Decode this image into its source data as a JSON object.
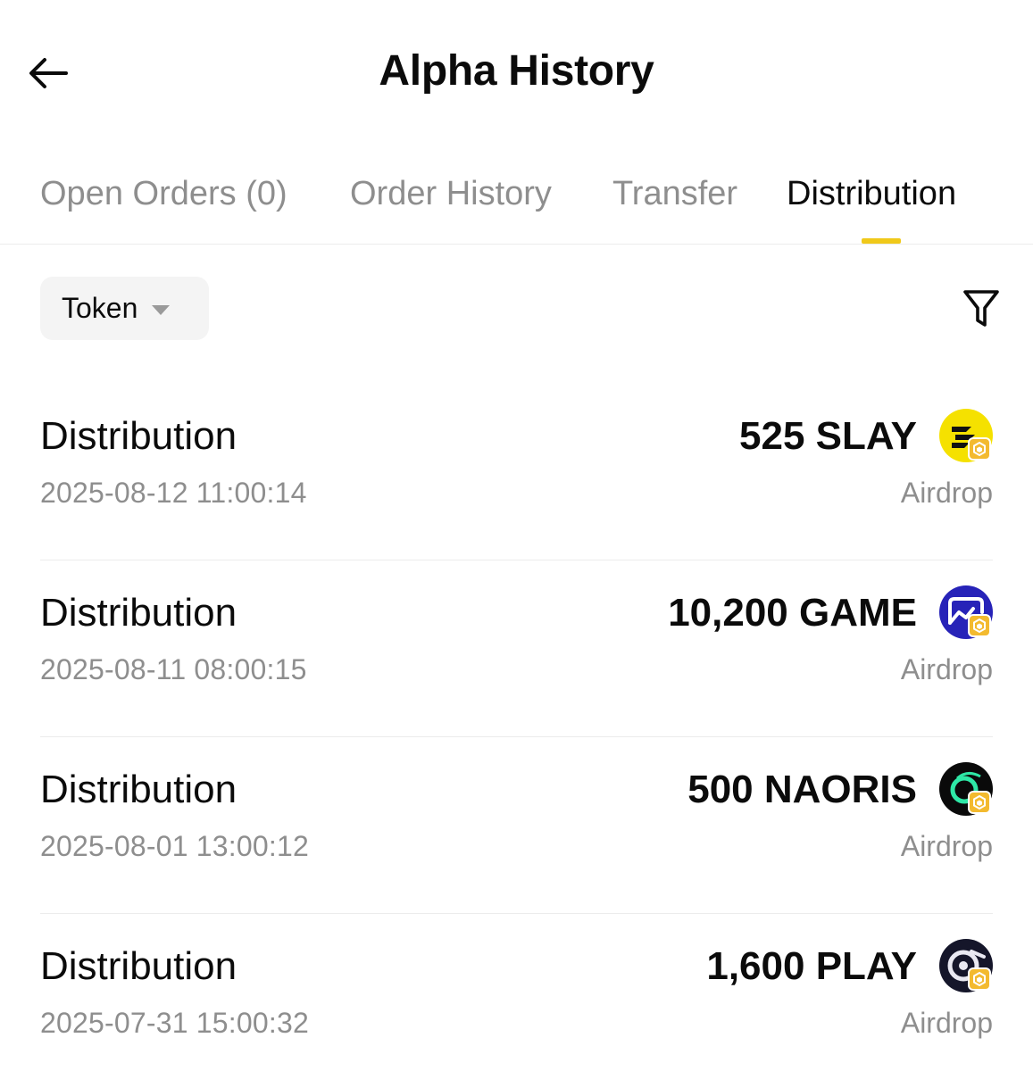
{
  "header": {
    "title": "Alpha History"
  },
  "tabs": [
    {
      "label": "Open Orders (0)",
      "active": false
    },
    {
      "label": "Order History",
      "active": false
    },
    {
      "label": "Transfer",
      "active": false
    },
    {
      "label": "Distribution",
      "active": true
    }
  ],
  "filter": {
    "token_label": "Token"
  },
  "colors": {
    "accent": "#f0c91a",
    "muted_text": "#8e8e8e",
    "divider": "#ececec"
  },
  "rows": [
    {
      "type": "Distribution",
      "date": "2025-08-12 11:00:14",
      "amount": "525 SLAY",
      "kind": "Airdrop",
      "icon": "slay-token-icon"
    },
    {
      "type": "Distribution",
      "date": "2025-08-11 08:00:15",
      "amount": "10,200 GAME",
      "kind": "Airdrop",
      "icon": "game-token-icon"
    },
    {
      "type": "Distribution",
      "date": "2025-08-01 13:00:12",
      "amount": "500 NAORIS",
      "kind": "Airdrop",
      "icon": "naoris-token-icon"
    },
    {
      "type": "Distribution",
      "date": "2025-07-31 15:00:32",
      "amount": "1,600 PLAY",
      "kind": "Airdrop",
      "icon": "play-token-icon"
    }
  ]
}
